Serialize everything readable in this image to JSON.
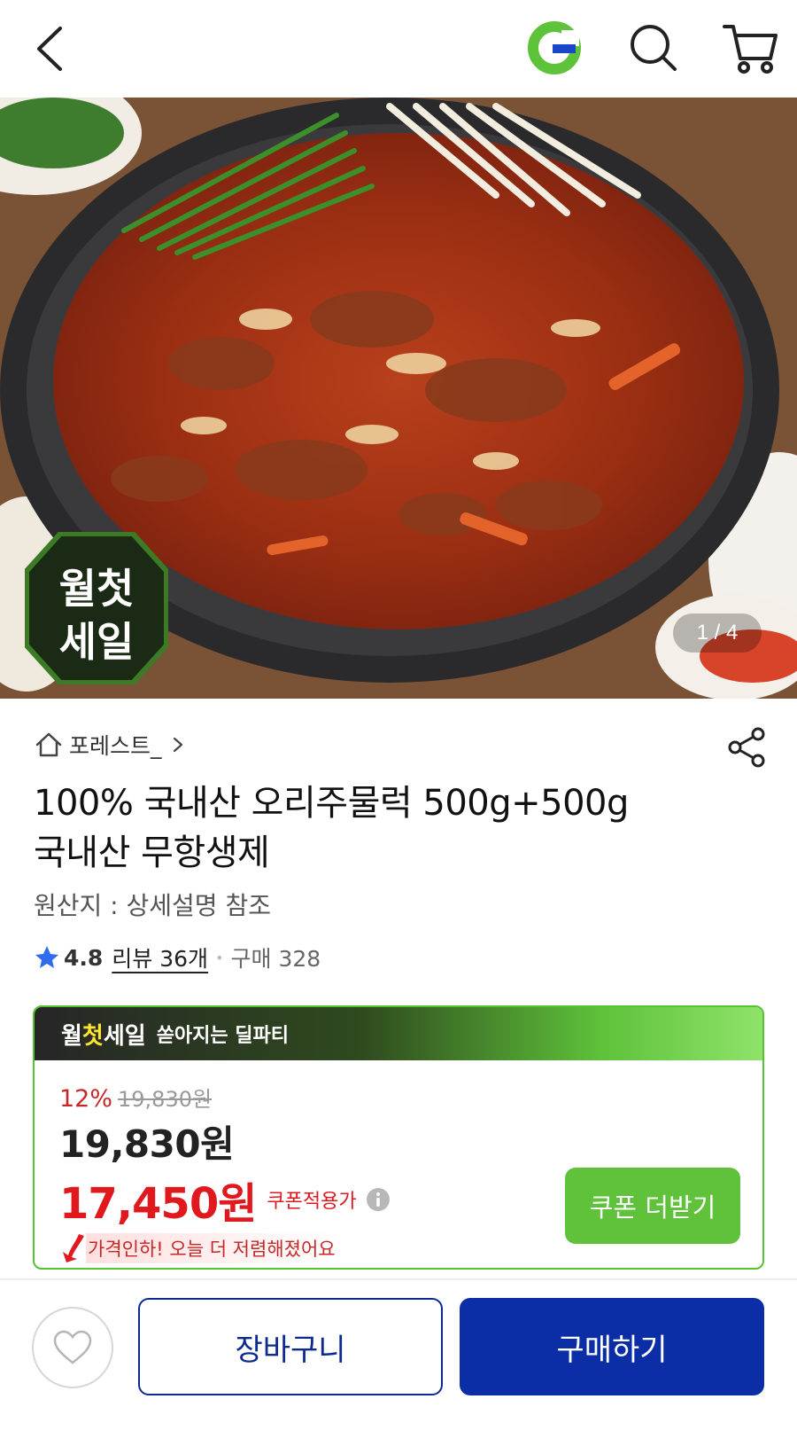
{
  "header": {
    "back_icon": "back-arrow-icon",
    "logo_icon": "gmarket-g-logo",
    "search_icon": "search-icon",
    "cart_icon": "cart-icon"
  },
  "hero": {
    "counter": "1 / 4",
    "badge_text_top": "월첫",
    "badge_text_bottom": "세일"
  },
  "product": {
    "store_name": "포레스트_",
    "title_line1": "100% 국내산 오리주물럭 500g+500g",
    "title_line2": "국내산 무항생제",
    "origin": "원산지 : 상세설명 참조",
    "rating": "4.8",
    "review_label": "리뷰 36개",
    "purchase_label": "구매 328"
  },
  "deal": {
    "banner_word1": "월",
    "banner_word2": "첫",
    "banner_word3": "세일",
    "banner_sub": "쏟아지는 딜파티",
    "discount_pct": "12%",
    "original_price": "19,830원",
    "sale_price": "19,830원",
    "coupon_price": "17,450원",
    "coupon_label": "쿠폰적용가",
    "price_drop_text": "가격인하! 오늘 더 저렴해졌어요",
    "coupon_button": "쿠폰 더받기"
  },
  "bottom_bar": {
    "wishlist_icon": "heart-icon",
    "cart_button": "장바구니",
    "buy_button": "구매하기"
  },
  "colors": {
    "brand_green": "#5fc23a",
    "buy_blue": "#0b2ea6",
    "price_red": "#e0191f"
  }
}
